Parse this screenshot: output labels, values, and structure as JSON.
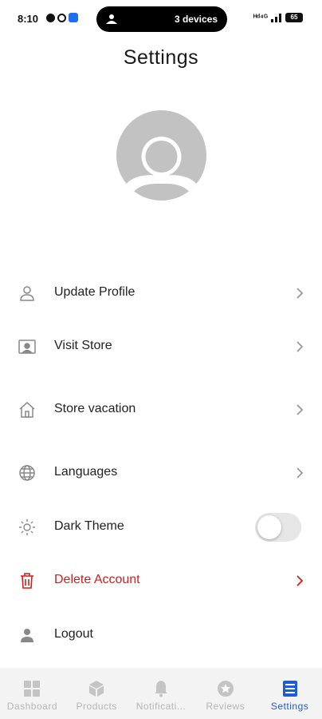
{
  "status_bar": {
    "time": "8:10",
    "pill_text": "3 devices",
    "network_text": "ᴴᵈ⁴ᴳ",
    "battery": "65"
  },
  "page": {
    "title": "Settings"
  },
  "menu": [
    {
      "label": "Update Profile",
      "icon": "user-icon"
    },
    {
      "label": "Visit Store",
      "icon": "store-card-icon"
    },
    {
      "label": "Store vacation",
      "icon": "home-icon"
    },
    {
      "label": "Languages",
      "icon": "globe-icon"
    },
    {
      "label": "Dark Theme",
      "icon": "sun-icon",
      "toggle_on": false
    },
    {
      "label": "Delete Account",
      "icon": "trash-icon"
    },
    {
      "label": "Logout",
      "icon": "person-icon"
    }
  ],
  "bottom_nav": [
    {
      "label": "Dashboard",
      "icon": "grid-icon"
    },
    {
      "label": "Products",
      "icon": "box-icon"
    },
    {
      "label": "Notificati...",
      "icon": "bell-icon"
    },
    {
      "label": "Reviews",
      "icon": "star-icon"
    },
    {
      "label": "Settings",
      "icon": "list-icon",
      "active": true
    }
  ],
  "colors": {
    "accent": "#1e5bd8",
    "danger": "#d01e1e",
    "inactive": "#b5b5b5"
  }
}
